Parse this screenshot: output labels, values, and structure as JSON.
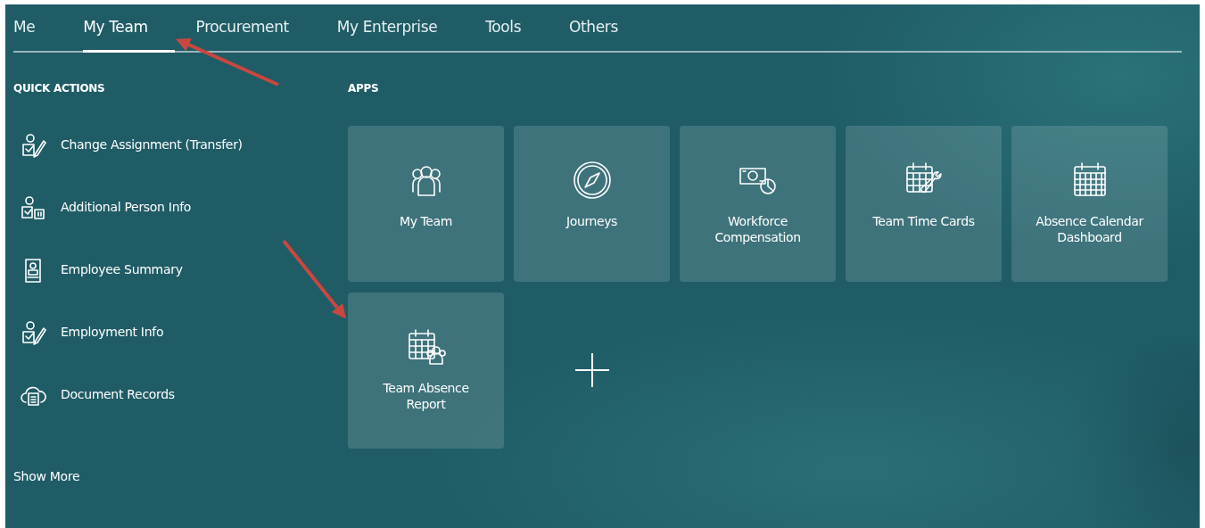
{
  "tabs": [
    {
      "label": "Me",
      "selected": false
    },
    {
      "label": "My Team",
      "selected": true
    },
    {
      "label": "Procurement",
      "selected": false
    },
    {
      "label": "My Enterprise",
      "selected": false
    },
    {
      "label": "Tools",
      "selected": false
    },
    {
      "label": "Others",
      "selected": false
    }
  ],
  "quick_actions": {
    "title": "QUICK ACTIONS",
    "items": [
      {
        "label": "Change Assignment (Transfer)",
        "kind": "person-edit"
      },
      {
        "label": "Additional Person Info",
        "kind": "person-card"
      },
      {
        "label": "Employee Summary",
        "kind": "badge"
      },
      {
        "label": "Employment Info",
        "kind": "person-edit"
      },
      {
        "label": "Document Records",
        "kind": "cloud-doc"
      }
    ],
    "show_more": "Show More"
  },
  "apps": {
    "title": "APPS",
    "tiles": [
      {
        "label": "My Team",
        "kind": "team"
      },
      {
        "label": "Journeys",
        "kind": "compass"
      },
      {
        "label": "Workforce Compensation",
        "kind": "money"
      },
      {
        "label": "Team Time Cards",
        "kind": "calendar-wrench"
      },
      {
        "label": "Absence Calendar Dashboard",
        "kind": "calendar"
      },
      {
        "label": "Team Absence Report",
        "kind": "calendar-team"
      }
    ],
    "add_tile": true
  }
}
